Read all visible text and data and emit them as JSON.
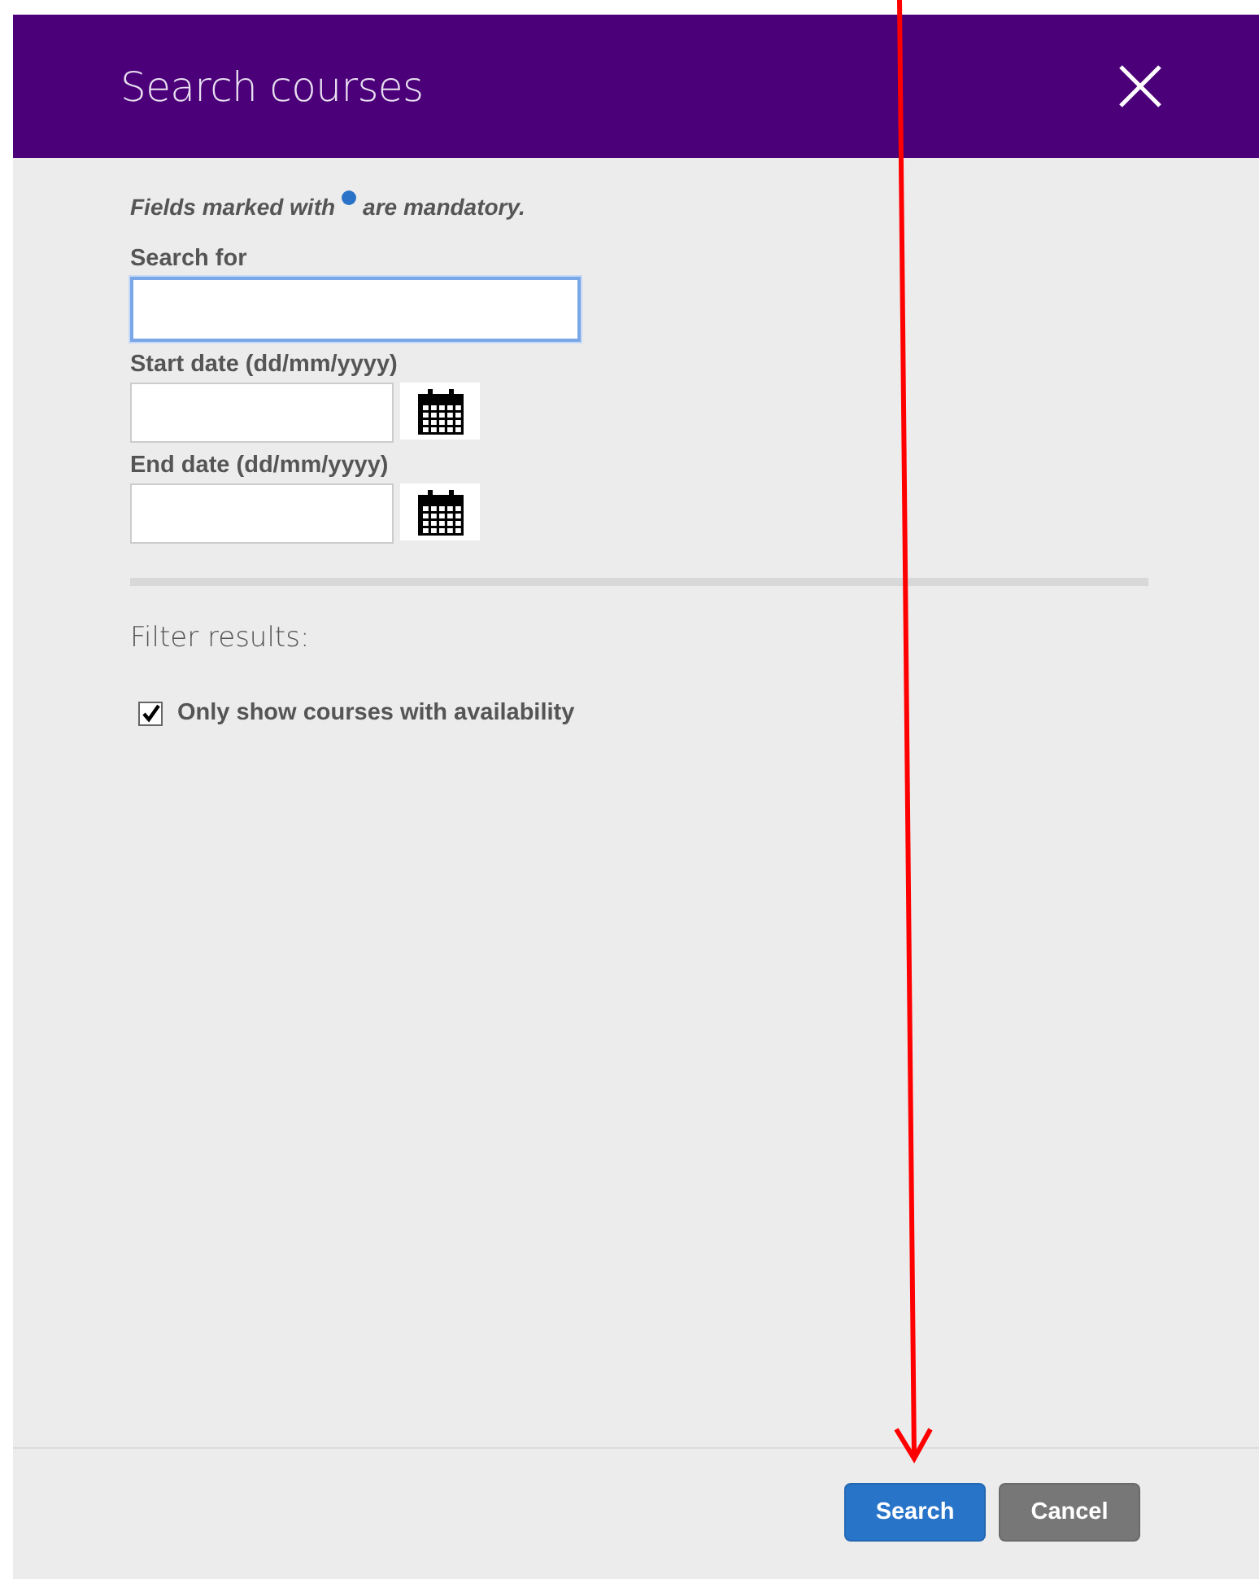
{
  "dialog": {
    "title": "Search courses"
  },
  "mandatory_note": {
    "before": "Fields marked with",
    "after": "are mandatory."
  },
  "fields": [
    {
      "label": "Search for",
      "kind": "text",
      "focused": true
    },
    {
      "label": "Start date (dd/mm/yyyy)",
      "kind": "date",
      "focused": false
    },
    {
      "label": "End date (dd/mm/yyyy)",
      "kind": "date",
      "focused": false
    }
  ],
  "filter": {
    "heading": "Filter results:",
    "options": [
      {
        "label": "Only show courses with availability",
        "checked": true
      }
    ]
  },
  "buttons": [
    {
      "label": "Search",
      "kind": "primary"
    },
    {
      "label": "Cancel",
      "kind": "secondary"
    }
  ],
  "annotation": {
    "kind": "arrow"
  }
}
